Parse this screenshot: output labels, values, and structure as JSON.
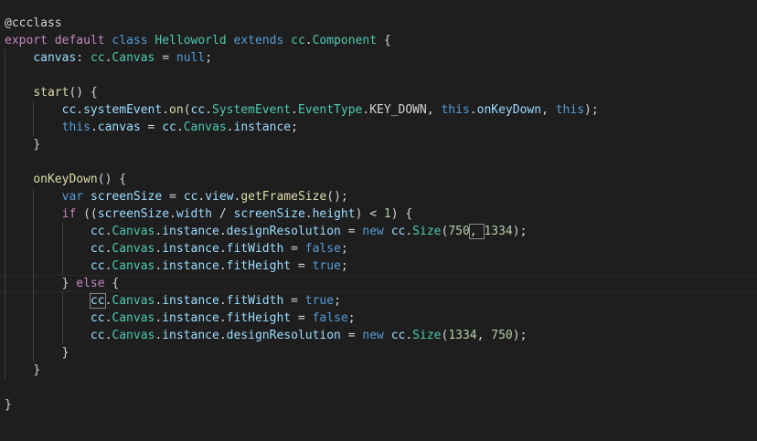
{
  "colors": {
    "background": "#1e1e1e",
    "keyword": "#569cd6",
    "control": "#c586c0",
    "type": "#4ec9b0",
    "function": "#dcdcaa",
    "variable": "#9cdcfe",
    "number": "#b5cea8",
    "text": "#d4d4d4"
  },
  "editor": {
    "cursor": {
      "line": 15,
      "after_token": 7
    },
    "bracket_match": [
      {
        "line": 12,
        "token": 15
      },
      {
        "line": 16,
        "token": 0
      }
    ],
    "lines": [
      {
        "indent": 0,
        "tokens": [
          {
            "t": "@ccclass",
            "c": "text"
          }
        ]
      },
      {
        "indent": 0,
        "tokens": [
          {
            "t": "export",
            "c": "control"
          },
          {
            "t": " ",
            "c": "text"
          },
          {
            "t": "default",
            "c": "control"
          },
          {
            "t": " ",
            "c": "text"
          },
          {
            "t": "class",
            "c": "keyword"
          },
          {
            "t": " ",
            "c": "text"
          },
          {
            "t": "Helloworld",
            "c": "type"
          },
          {
            "t": " ",
            "c": "text"
          },
          {
            "t": "extends",
            "c": "keyword"
          },
          {
            "t": " ",
            "c": "text"
          },
          {
            "t": "cc",
            "c": "type"
          },
          {
            "t": ".",
            "c": "text"
          },
          {
            "t": "Component",
            "c": "type"
          },
          {
            "t": " {",
            "c": "text"
          }
        ]
      },
      {
        "indent": 1,
        "tokens": [
          {
            "t": "canvas",
            "c": "variable"
          },
          {
            "t": ": ",
            "c": "text"
          },
          {
            "t": "cc",
            "c": "type"
          },
          {
            "t": ".",
            "c": "text"
          },
          {
            "t": "Canvas",
            "c": "type"
          },
          {
            "t": " = ",
            "c": "text"
          },
          {
            "t": "null",
            "c": "keyword"
          },
          {
            "t": ";",
            "c": "text"
          }
        ]
      },
      {
        "indent": 1,
        "tokens": []
      },
      {
        "indent": 1,
        "tokens": [
          {
            "t": "start",
            "c": "function"
          },
          {
            "t": "() {",
            "c": "text"
          }
        ]
      },
      {
        "indent": 2,
        "tokens": [
          {
            "t": "cc",
            "c": "variable"
          },
          {
            "t": ".",
            "c": "text"
          },
          {
            "t": "systemEvent",
            "c": "variable"
          },
          {
            "t": ".",
            "c": "text"
          },
          {
            "t": "on",
            "c": "function"
          },
          {
            "t": "(",
            "c": "text"
          },
          {
            "t": "cc",
            "c": "variable"
          },
          {
            "t": ".",
            "c": "text"
          },
          {
            "t": "SystemEvent",
            "c": "type"
          },
          {
            "t": ".",
            "c": "text"
          },
          {
            "t": "EventType",
            "c": "type"
          },
          {
            "t": ".",
            "c": "text"
          },
          {
            "t": "KEY_DOWN",
            "c": "text"
          },
          {
            "t": ", ",
            "c": "text"
          },
          {
            "t": "this",
            "c": "keyword"
          },
          {
            "t": ".",
            "c": "text"
          },
          {
            "t": "onKeyDown",
            "c": "variable"
          },
          {
            "t": ", ",
            "c": "text"
          },
          {
            "t": "this",
            "c": "keyword"
          },
          {
            "t": ");",
            "c": "text"
          }
        ]
      },
      {
        "indent": 2,
        "tokens": [
          {
            "t": "this",
            "c": "keyword"
          },
          {
            "t": ".",
            "c": "text"
          },
          {
            "t": "canvas",
            "c": "variable"
          },
          {
            "t": " = ",
            "c": "text"
          },
          {
            "t": "cc",
            "c": "variable"
          },
          {
            "t": ".",
            "c": "text"
          },
          {
            "t": "Canvas",
            "c": "type"
          },
          {
            "t": ".",
            "c": "text"
          },
          {
            "t": "instance",
            "c": "variable"
          },
          {
            "t": ";",
            "c": "text"
          }
        ]
      },
      {
        "indent": 1,
        "tokens": [
          {
            "t": "}",
            "c": "text"
          }
        ]
      },
      {
        "indent": 1,
        "tokens": []
      },
      {
        "indent": 1,
        "tokens": [
          {
            "t": "onKeyDown",
            "c": "function"
          },
          {
            "t": "() {",
            "c": "text"
          }
        ]
      },
      {
        "indent": 2,
        "tokens": [
          {
            "t": "var",
            "c": "keyword"
          },
          {
            "t": " ",
            "c": "text"
          },
          {
            "t": "screenSize",
            "c": "variable"
          },
          {
            "t": " = ",
            "c": "text"
          },
          {
            "t": "cc",
            "c": "variable"
          },
          {
            "t": ".",
            "c": "text"
          },
          {
            "t": "view",
            "c": "variable"
          },
          {
            "t": ".",
            "c": "text"
          },
          {
            "t": "getFrameSize",
            "c": "function"
          },
          {
            "t": "();",
            "c": "text"
          }
        ]
      },
      {
        "indent": 2,
        "tokens": [
          {
            "t": "if",
            "c": "control"
          },
          {
            "t": " ((",
            "c": "text"
          },
          {
            "t": "screenSize",
            "c": "variable"
          },
          {
            "t": ".",
            "c": "text"
          },
          {
            "t": "width",
            "c": "variable"
          },
          {
            "t": " / ",
            "c": "text"
          },
          {
            "t": "screenSize",
            "c": "variable"
          },
          {
            "t": ".",
            "c": "text"
          },
          {
            "t": "height",
            "c": "variable"
          },
          {
            "t": ") < ",
            "c": "text"
          },
          {
            "t": "1",
            "c": "number"
          },
          {
            "t": ") ",
            "c": "text"
          },
          {
            "t": "{",
            "c": "text"
          }
        ]
      },
      {
        "indent": 3,
        "tokens": [
          {
            "t": "cc",
            "c": "variable"
          },
          {
            "t": ".",
            "c": "text"
          },
          {
            "t": "Canvas",
            "c": "type"
          },
          {
            "t": ".",
            "c": "text"
          },
          {
            "t": "instance",
            "c": "variable"
          },
          {
            "t": ".",
            "c": "text"
          },
          {
            "t": "designResolution",
            "c": "variable"
          },
          {
            "t": " = ",
            "c": "text"
          },
          {
            "t": "new",
            "c": "keyword"
          },
          {
            "t": " ",
            "c": "text"
          },
          {
            "t": "cc",
            "c": "variable"
          },
          {
            "t": ".",
            "c": "text"
          },
          {
            "t": "Size",
            "c": "type"
          },
          {
            "t": "(",
            "c": "text"
          },
          {
            "t": "750",
            "c": "number"
          },
          {
            "t": ", ",
            "c": "text"
          },
          {
            "t": "1334",
            "c": "number"
          },
          {
            "t": ");",
            "c": "text"
          }
        ]
      },
      {
        "indent": 3,
        "tokens": [
          {
            "t": "cc",
            "c": "variable"
          },
          {
            "t": ".",
            "c": "text"
          },
          {
            "t": "Canvas",
            "c": "type"
          },
          {
            "t": ".",
            "c": "text"
          },
          {
            "t": "instance",
            "c": "variable"
          },
          {
            "t": ".",
            "c": "text"
          },
          {
            "t": "fitWidth",
            "c": "variable"
          },
          {
            "t": " = ",
            "c": "text"
          },
          {
            "t": "false",
            "c": "keyword"
          },
          {
            "t": ";",
            "c": "text"
          }
        ]
      },
      {
        "indent": 3,
        "tokens": [
          {
            "t": "cc",
            "c": "variable"
          },
          {
            "t": ".",
            "c": "text"
          },
          {
            "t": "Canvas",
            "c": "type"
          },
          {
            "t": ".",
            "c": "text"
          },
          {
            "t": "instance",
            "c": "variable"
          },
          {
            "t": ".",
            "c": "text"
          },
          {
            "t": "fitHeight",
            "c": "variable"
          },
          {
            "t": " = ",
            "c": "text"
          },
          {
            "t": "true",
            "c": "keyword"
          },
          {
            "t": ";",
            "c": "text"
          }
        ]
      },
      {
        "indent": 2,
        "tokens": [
          {
            "t": "}",
            "c": "text"
          },
          {
            "t": " ",
            "c": "text"
          },
          {
            "t": "else",
            "c": "control"
          },
          {
            "t": " {",
            "c": "text"
          }
        ]
      },
      {
        "indent": 3,
        "tokens": [
          {
            "t": "cc",
            "c": "variable"
          },
          {
            "t": ".",
            "c": "text"
          },
          {
            "t": "Canvas",
            "c": "type"
          },
          {
            "t": ".",
            "c": "text"
          },
          {
            "t": "instance",
            "c": "variable"
          },
          {
            "t": ".",
            "c": "text"
          },
          {
            "t": "fitWidth",
            "c": "variable"
          },
          {
            "t": " = ",
            "c": "text"
          },
          {
            "t": "true",
            "c": "keyword"
          },
          {
            "t": ";",
            "c": "text"
          }
        ]
      },
      {
        "indent": 3,
        "tokens": [
          {
            "t": "cc",
            "c": "variable"
          },
          {
            "t": ".",
            "c": "text"
          },
          {
            "t": "Canvas",
            "c": "type"
          },
          {
            "t": ".",
            "c": "text"
          },
          {
            "t": "instance",
            "c": "variable"
          },
          {
            "t": ".",
            "c": "text"
          },
          {
            "t": "fitHeight",
            "c": "variable"
          },
          {
            "t": " = ",
            "c": "text"
          },
          {
            "t": "false",
            "c": "keyword"
          },
          {
            "t": ";",
            "c": "text"
          }
        ]
      },
      {
        "indent": 3,
        "tokens": [
          {
            "t": "cc",
            "c": "variable"
          },
          {
            "t": ".",
            "c": "text"
          },
          {
            "t": "Canvas",
            "c": "type"
          },
          {
            "t": ".",
            "c": "text"
          },
          {
            "t": "instance",
            "c": "variable"
          },
          {
            "t": ".",
            "c": "text"
          },
          {
            "t": "designResolution",
            "c": "variable"
          },
          {
            "t": " = ",
            "c": "text"
          },
          {
            "t": "new",
            "c": "keyword"
          },
          {
            "t": " ",
            "c": "text"
          },
          {
            "t": "cc",
            "c": "variable"
          },
          {
            "t": ".",
            "c": "text"
          },
          {
            "t": "Size",
            "c": "type"
          },
          {
            "t": "(",
            "c": "text"
          },
          {
            "t": "1334",
            "c": "number"
          },
          {
            "t": ", ",
            "c": "text"
          },
          {
            "t": "750",
            "c": "number"
          },
          {
            "t": ");",
            "c": "text"
          }
        ]
      },
      {
        "indent": 2,
        "tokens": [
          {
            "t": "}",
            "c": "text"
          }
        ]
      },
      {
        "indent": 1,
        "tokens": [
          {
            "t": "}",
            "c": "text"
          }
        ]
      },
      {
        "indent": 0,
        "tokens": []
      },
      {
        "indent": 0,
        "tokens": [
          {
            "t": "}",
            "c": "text"
          }
        ]
      }
    ]
  }
}
